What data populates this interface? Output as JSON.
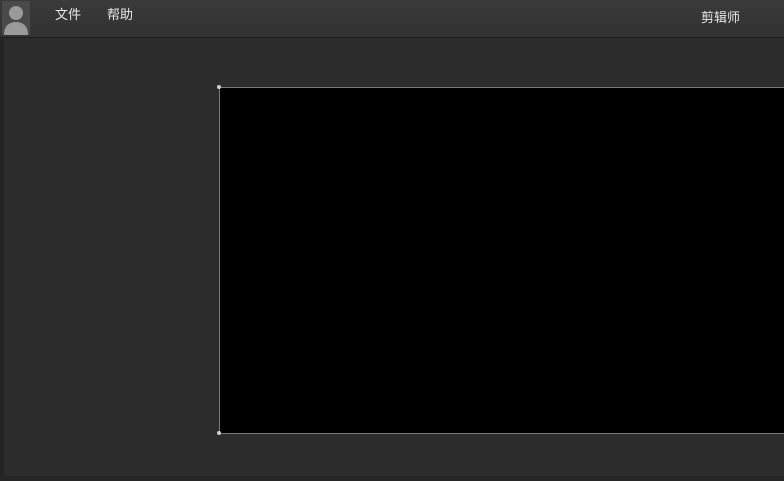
{
  "menu": {
    "file_label": "文件",
    "help_label": "帮助"
  },
  "header": {
    "role_label": "剪辑师"
  },
  "icons": {
    "avatar": "user-avatar-icon"
  },
  "colors": {
    "background": "#2c2c2c",
    "topbar": "#353535",
    "preview_bg": "#000000",
    "preview_border": "#7a7a7a",
    "text": "#e8e8e8"
  }
}
